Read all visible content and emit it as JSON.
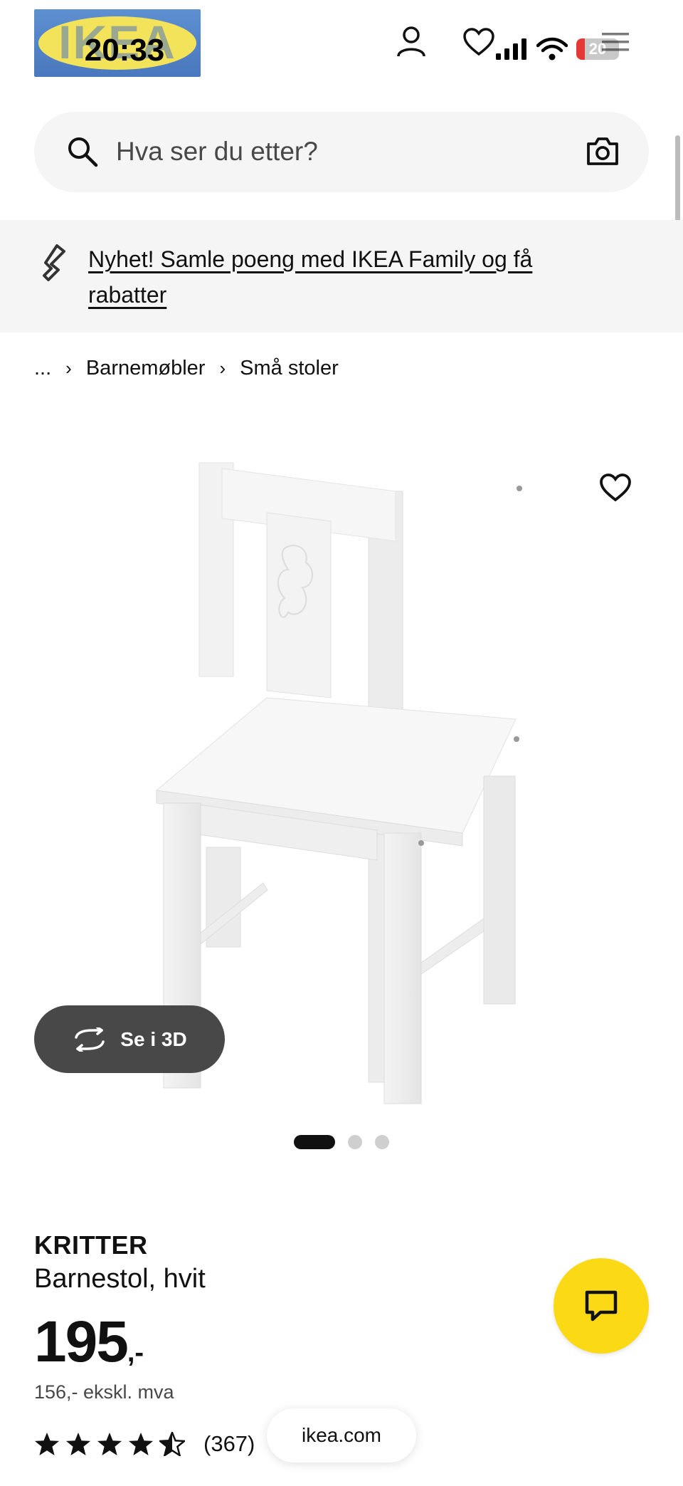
{
  "status_bar": {
    "time": "20:33",
    "battery_level": "20",
    "battery_fraction": 0.2
  },
  "header": {
    "logo_text": "IKEA",
    "icons": [
      "user-icon",
      "heart-icon",
      "cart-icon",
      "menu-icon"
    ]
  },
  "search": {
    "placeholder": "Hva ser du etter?"
  },
  "banner": {
    "text": "Nyhet! Samle poeng med IKEA Family og få rabatter"
  },
  "breadcrumb": {
    "items": [
      "...",
      "Barnemøbler",
      "Små stoler"
    ]
  },
  "gallery": {
    "view_3d_label": "Se i 3D",
    "active_index": 0,
    "total": 3
  },
  "product": {
    "name": "KRITTER",
    "description": "Barnestol, hvit",
    "price": "195",
    "price_suffix": ",-",
    "price_ex_vat": "156,- ekskl. mva",
    "rating": 4.5,
    "rating_count": "(367)"
  },
  "browser": {
    "url": "ikea.com"
  },
  "colors": {
    "accent_yellow": "#fbd914",
    "ikea_blue": "#0058a3",
    "dark_button": "#484848",
    "banner_bg": "#f5f5f5"
  }
}
